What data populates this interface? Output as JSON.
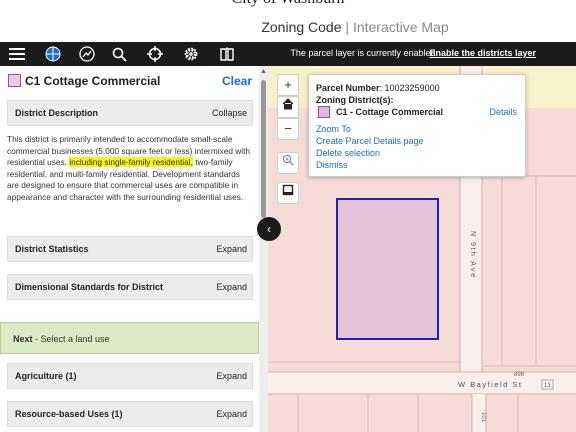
{
  "header": {
    "site_title": "City of Washburn",
    "subtitle_left": "Zoning Code",
    "subtitle_sep": "|",
    "subtitle_right": "Interactive Map"
  },
  "toolbar": {
    "tools": [
      "menu-icon",
      "globe-icon",
      "chart-icon",
      "search-icon",
      "crosshair-icon",
      "gear-icon",
      "book-icon"
    ],
    "message": "The parcel layer is currently enabled.",
    "link": "Enable the districts layer"
  },
  "panel": {
    "zone_title": "C1 Cottage Commercial",
    "clear_label": "Clear",
    "description_section": {
      "label": "District Description",
      "action": "Collapse"
    },
    "description_before": "This district is primarily intended to accommodate small-scale commercial businesses (5,000 square feet or less) intermixed with residential uses,",
    "description_highlight": "including single-family residential,",
    "description_after": "two-family residential, and multi-family residential. Development standards are designed to ensure that commercial uses are compatible in appearance and character with the surrounding residential uses.",
    "stats_section": {
      "label": "District Statistics",
      "action": "Expand"
    },
    "dimensional_section": {
      "label": "Dimensional Standards for District",
      "action": "Expand"
    },
    "next_bold": "Next",
    "next_text": " - Select a land use",
    "agriculture_section": {
      "label": "Agriculture (1)",
      "action": "Expand"
    },
    "resource_section": {
      "label": "Resource-based Uses (1)",
      "action": "Expand"
    }
  },
  "map": {
    "controls": [
      "+",
      "−"
    ],
    "street_labels": [
      "N 9th Ave",
      "W Bayfield St",
      "898",
      "13",
      "101"
    ],
    "popup": {
      "parcel_label": "Parcel Number",
      "parcel_value": ": 10023259000",
      "zoning_label": "Zoning District(s):",
      "zone_name": "C1 - Cottage Commercial",
      "details": "Details",
      "links": [
        "Zoom To",
        "Create Parcel Details page",
        "Delete selection",
        "Dismiss"
      ]
    }
  },
  "colors": {
    "toolbar": "#1b1b1b",
    "link": "#1a6fbf",
    "swatch": "#f2c6e6",
    "highlight": "#f6f31a",
    "next_bar": "#dcebc5",
    "map_fill": "#f6dcd8",
    "parcel_fill": "#e6c3dc",
    "parcel_border": "#1f1fb0"
  }
}
